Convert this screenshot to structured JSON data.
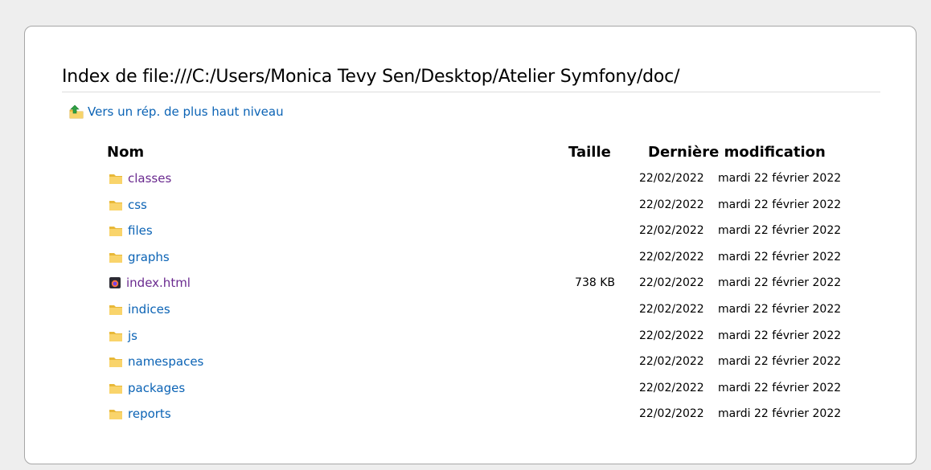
{
  "page": {
    "title": "Index de file:///C:/Users/Monica Tevy Sen/Desktop/Atelier Symfony/doc/",
    "up_link": "Vers un rép. de plus haut niveau"
  },
  "table": {
    "headers": {
      "name": "Nom",
      "size": "Taille",
      "modified": "Dernière modification"
    },
    "rows": [
      {
        "name": "classes",
        "type": "folder",
        "visited": true,
        "size": "",
        "date": "22/02/2022",
        "time": "mardi 22 février 2022"
      },
      {
        "name": "css",
        "type": "folder",
        "visited": false,
        "size": "",
        "date": "22/02/2022",
        "time": "mardi 22 février 2022"
      },
      {
        "name": "files",
        "type": "folder",
        "visited": false,
        "size": "",
        "date": "22/02/2022",
        "time": "mardi 22 février 2022"
      },
      {
        "name": "graphs",
        "type": "folder",
        "visited": false,
        "size": "",
        "date": "22/02/2022",
        "time": "mardi 22 février 2022"
      },
      {
        "name": "index.html",
        "type": "html-file",
        "visited": true,
        "size": "738 KB",
        "date": "22/02/2022",
        "time": "mardi 22 février 2022"
      },
      {
        "name": "indices",
        "type": "folder",
        "visited": false,
        "size": "",
        "date": "22/02/2022",
        "time": "mardi 22 février 2022"
      },
      {
        "name": "js",
        "type": "folder",
        "visited": false,
        "size": "",
        "date": "22/02/2022",
        "time": "mardi 22 février 2022"
      },
      {
        "name": "namespaces",
        "type": "folder",
        "visited": false,
        "size": "",
        "date": "22/02/2022",
        "time": "mardi 22 février 2022"
      },
      {
        "name": "packages",
        "type": "folder",
        "visited": false,
        "size": "",
        "date": "22/02/2022",
        "time": "mardi 22 février 2022"
      },
      {
        "name": "reports",
        "type": "folder",
        "visited": false,
        "size": "",
        "date": "22/02/2022",
        "time": "mardi 22 février 2022"
      }
    ]
  },
  "icons": {
    "up": "folder-up-icon",
    "folder": "folder-icon",
    "html_file": "html-file-icon"
  },
  "colors": {
    "link": "#0b63b5",
    "visited_link": "#6a2a8f",
    "background": "#eeeeee",
    "panel": "#ffffff"
  }
}
